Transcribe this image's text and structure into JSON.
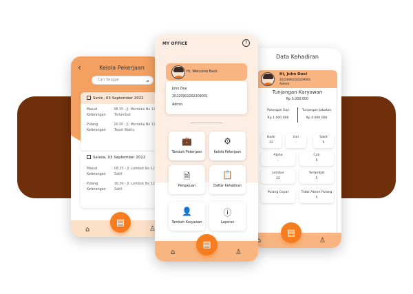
{
  "colors": {
    "accent": "#f57c1f",
    "accent_light": "#f8b581",
    "background_band": "#6f2f0b"
  },
  "left_screen": {
    "title": "Kelola Pekerjaan",
    "search_placeholder": "Cari Tanggal",
    "days": [
      {
        "date": "Senin, 03 September 2022",
        "rows": [
          {
            "key": "Masuk",
            "value": "08.35 - Jl. Merdeka No 123"
          },
          {
            "key": "Keterangan",
            "value": "Terlambat"
          },
          {
            "key": "Pulang",
            "value": "16.00 - Jl. Merdeka No 123"
          },
          {
            "key": "Keterangan",
            "value": "Tepat Waktu"
          }
        ]
      },
      {
        "date": "Selasa, 03 September 2022",
        "rows": [
          {
            "key": "Masuk",
            "value": "08.35 - Jl. Lombok No 123"
          },
          {
            "key": "Keterangan",
            "value": "Sakit"
          },
          {
            "key": "Pulang",
            "value": "16.00 - Jl. Lombok No 123"
          },
          {
            "key": "Keterangan",
            "value": "Sakit"
          }
        ]
      }
    ]
  },
  "center_screen": {
    "app_title": "MY OFFICE",
    "welcome": "Hi, Welcome Back",
    "profile": {
      "name": "John Doe",
      "id": "20220902202209001",
      "role": "Admin"
    },
    "menu": [
      {
        "label": "Tambah Pekerjaan",
        "icon": "briefcase-icon"
      },
      {
        "label": "Kelola Pekerjaan",
        "icon": "briefcase-settings-icon"
      },
      {
        "label": "Pengajuan",
        "icon": "document-icon"
      },
      {
        "label": "Daftar Kehadiran",
        "icon": "clipboard-list-icon"
      },
      {
        "label": "Tambah Karyawan",
        "icon": "add-user-icon"
      },
      {
        "label": "Laporan",
        "icon": "alert-circle-icon"
      }
    ]
  },
  "right_screen": {
    "title": "Data Kehadiran",
    "greeting": "Hi, John Doe!",
    "id": "20220902202209001",
    "role": "Admin",
    "tunjangan_label": "Tunjangan Karyawan",
    "tunjangan_value": "Rp 5.000.000",
    "potongan_label": "Potongan Gaji",
    "potongan_value": "Rp 1.000.000",
    "jabatan_label": "Tunjangan Jabatan",
    "jabatan_value": "Rp 4.000.000",
    "stats": [
      {
        "label": "Hadir",
        "value": "22"
      },
      {
        "label": "Izin",
        "value": "-"
      },
      {
        "label": "Sakit",
        "value": "5"
      },
      {
        "label": "Alpha",
        "value": "-"
      },
      {
        "label": "Cuti",
        "value": "5"
      },
      {
        "label": "Lembur",
        "value": "22"
      },
      {
        "label": "Terlambat",
        "value": "5"
      },
      {
        "label": "Pulang Cepat",
        "value": "-"
      },
      {
        "label": "Tidak Absen Pulang",
        "value": "5"
      }
    ]
  },
  "nav": {
    "home_icon": "home-icon",
    "center_icon": "clipboard-icon",
    "profile_icon": "user-icon"
  }
}
